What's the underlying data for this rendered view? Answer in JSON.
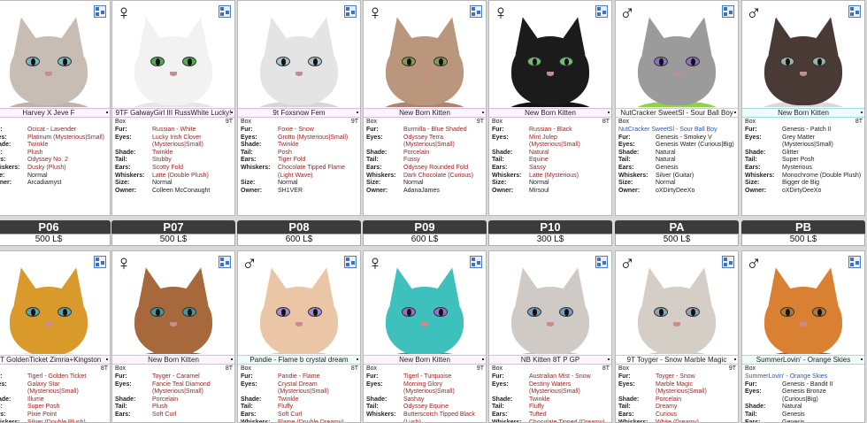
{
  "top_cards": [
    {
      "gender": "",
      "name": "Harvey X Jeve F",
      "tag": "",
      "box_right": "",
      "fur": "Ocicat - Lavender",
      "eyes": "Platinum (Mysterious|Small)",
      "shade": "Twinkle",
      "tail": "Plush",
      "ears": "Odyssey No. 2",
      "whiskers": "Dusky (Plush)",
      "size": "Normal",
      "owner": "Arcadiamyst",
      "colors": {
        "fur": "#c8bdb4",
        "body": "#bfb2a6",
        "eye": "#7bb8c2"
      }
    },
    {
      "gender": "♀",
      "name": "9TF GalwayGirl III RussWhite Lucky!",
      "tag": "Box",
      "box_right": "9T",
      "fur": "Russian - White",
      "eyes": "Lucky Irish Clover (Mysterious|Small)",
      "shade": "Twinkle",
      "tail": "Stubby",
      "ears": "Scotty Fold",
      "whiskers": "Latte (Double Plush)",
      "size": "Normal",
      "owner": "Colleen McConaught",
      "colors": {
        "fur": "#f2f2f2",
        "body": "#e6e6e6",
        "eye": "#4caf50"
      }
    },
    {
      "gender": "",
      "name": "9t Foxsnow Fem",
      "tag": "Box",
      "box_right": "9T",
      "fur": "Foxie - Snow",
      "eyes": "Grotto (Mysterious|Small)",
      "shade": "Twinkle",
      "tail": "Posh",
      "ears": "Tiger Fold",
      "whiskers": "Chocolate Tipped Flame (Light Wave)",
      "size": "Normal",
      "owner": "SH1VER",
      "colors": {
        "fur": "#e4e4e4",
        "body": "#d6d6d6",
        "eye": "#a9c7cf"
      }
    },
    {
      "gender": "♀",
      "name": "New Born Kitten",
      "tag": "Box",
      "box_right": "9T",
      "fur": "Burmilla - Blue Shaded",
      "eyes": "Odyssey Terra (Mysterious|Small)",
      "shade": "Porcelain",
      "tail": "Fussy",
      "ears": "Odyssey Rounded Fold",
      "whiskers": "Dark Chocolate (Curious)",
      "size": "Normal",
      "owner": "AdanaJames",
      "colors": {
        "fur": "#b9967c",
        "body": "#a88770",
        "eye": "#8a9a4a"
      }
    },
    {
      "gender": "♀",
      "name": "New Born Kitten",
      "tag": "Box",
      "box_right": "8T",
      "fur": "Russian - Black",
      "eyes": "Mint Julep (Mysterious|Small)",
      "shade": "Natural",
      "tail": "Equine",
      "ears": "Sassy",
      "whiskers": "Latte (Mysterious)",
      "size": "Normal",
      "owner": "Mirsoul",
      "colors": {
        "fur": "#1b1b1b",
        "body": "#151515",
        "eye": "#6fbf73"
      }
    },
    {
      "gender": "♂",
      "name": "NutCracker SweetSl - Sour Ball Boy",
      "tag": "Box",
      "box_right": "",
      "sub": "NutCracker SweetSl - Sour Ball Boy",
      "fur": "Genesis - Smokey V",
      "eyes": "Genesis Water (Curious|Big)",
      "shade": "Natural",
      "tail": "Natural",
      "ears": "Genesis",
      "whiskers": "Silver (Guitar)",
      "size": "Normal",
      "owner": "oXDirtyDeeXo",
      "colors": {
        "fur": "#9b9b9b",
        "body": "#8ed14b",
        "eye": "#8f6fc4"
      }
    },
    {
      "gender": "♂",
      "name": "New Born Kitten",
      "tag": "Box",
      "box_right": "8T",
      "fur": "Genesis - Patch II",
      "eyes": "Grey Matter (Mysterious|Small)",
      "shade": "Glitter",
      "tail": "Super Posh",
      "ears": "Mysterious",
      "whiskers": "Monochrome (Double Plush)",
      "size": "Bigger de Big",
      "owner": "oXDirtyDeeXo",
      "colors": {
        "fur": "#4a3a35",
        "body": "#d9d9d9",
        "eye": "#9bb0a6"
      }
    }
  ],
  "prices": [
    {
      "label": "P06",
      "price": "500 L$"
    },
    {
      "label": "P07",
      "price": "500 L$"
    },
    {
      "label": "P08",
      "price": "600 L$"
    },
    {
      "label": "P09",
      "price": "600 L$"
    },
    {
      "label": "P10",
      "price": "300 L$"
    },
    {
      "label": "PA",
      "price": "500 L$"
    },
    {
      "label": "PB",
      "price": "500 L$"
    }
  ],
  "bottom_cards": [
    {
      "gender": "",
      "name": "8T GoldenTicket Zimria+Kingston",
      "tag": "",
      "box_right": "8T",
      "fur": "Tigerl - Golden Ticket",
      "eyes": "Galaxy Star (Mysterious|Small)",
      "shade": "Illume",
      "tail": "Super Posh",
      "ears": "Pixie Point",
      "whiskers": "Silver (Double Plush)",
      "colors": {
        "fur": "#d99a2b",
        "body": "#f1e6d3",
        "eye": "#5fa2a8"
      }
    },
    {
      "gender": "♀",
      "name": "New Born Kitten",
      "tag": "Box",
      "box_right": "8T",
      "fur": "Toyger - Caramel",
      "eyes": "Fancie Teal Diamond (Mysterious|Small)",
      "shade": "Porcelain",
      "tail": "Plush",
      "ears": "Soft Curl",
      "colors": {
        "fur": "#a7683b",
        "body": "#8d5a33",
        "eye": "#3f9aa3"
      }
    },
    {
      "gender": "♂",
      "name": "Pandie - Flame b crystal dream",
      "tag": "Box",
      "box_right": "8T",
      "fur": "Pandie - Flame",
      "eyes": "Crystal Dream (Mysterious|Small)",
      "shade": "Twinkle",
      "tail": "Fluffy",
      "ears": "Soft Curl",
      "whiskers": "Flame (Double Dreamy)",
      "colors": {
        "fur": "#eac6a6",
        "body": "#e2bb98",
        "eye": "#a68ad8"
      }
    },
    {
      "gender": "♀",
      "name": "New Born Kitten",
      "tag": "Box",
      "box_right": "9T",
      "fur": "Tigerl - Turquoise",
      "eyes": "Morning Glory (Mysterious|Small)",
      "shade": "Sashay",
      "tail": "Odyssey Equine",
      "ears": "",
      "whiskers": "Butterscotch Tipped Black (Lush)",
      "colors": {
        "fur": "#3ec1bd",
        "body": "#2a9e9a",
        "eye": "#9b6cd0"
      }
    },
    {
      "gender": "",
      "name": "NB Kitten 8T P GP",
      "tag": "Box",
      "box_right": "8T",
      "fur": "Australian Mist - Snow",
      "eyes": "Destiny Waters (Mysterious|Small)",
      "shade": "Twinkle",
      "tail": "Fluffy",
      "ears": "Tufted",
      "whiskers": "Chocolate Tipped (Dreamy)",
      "colors": {
        "fur": "#cfcac6",
        "body": "#bfb9b3",
        "eye": "#7a9ac0"
      }
    },
    {
      "gender": "♂",
      "name": "9T Toyger - Snow Marble Magic",
      "tag": "Box",
      "box_right": "9T",
      "fur": "Toyger - Snow",
      "eyes": "Marble Magic (Mysterious|Small)",
      "shade": "Porcelain",
      "tail": "Dreamy",
      "ears": "Curious",
      "whiskers": "White (Dreamy)",
      "colors": {
        "fur": "#d4cec7",
        "body": "#c7c1ba",
        "eye": "#8fa3b3"
      }
    },
    {
      "gender": "♂",
      "name": "SummerLovin' - Orange Skies",
      "tag": "Box",
      "box_right": "",
      "sub": "SummerLovin' - Orange Skies",
      "fur": "Genesis - Bandit II",
      "eyes": "Genesis Bronze (Curious|Big)",
      "shade": "Natural",
      "tail": "Genesis",
      "ears": "Genesis",
      "whiskers": "Silver (Guitar)",
      "colors": {
        "fur": "#d98032",
        "body": "#c2442a",
        "eye": "#b67a2e"
      }
    }
  ],
  "labels": {
    "fur": "Fur:",
    "eyes": "Eyes:",
    "shade": "Shade:",
    "tail": "Tail:",
    "ears": "Ears:",
    "whiskers": "Whiskers:",
    "size": "Size:",
    "owner": "Owner:"
  }
}
